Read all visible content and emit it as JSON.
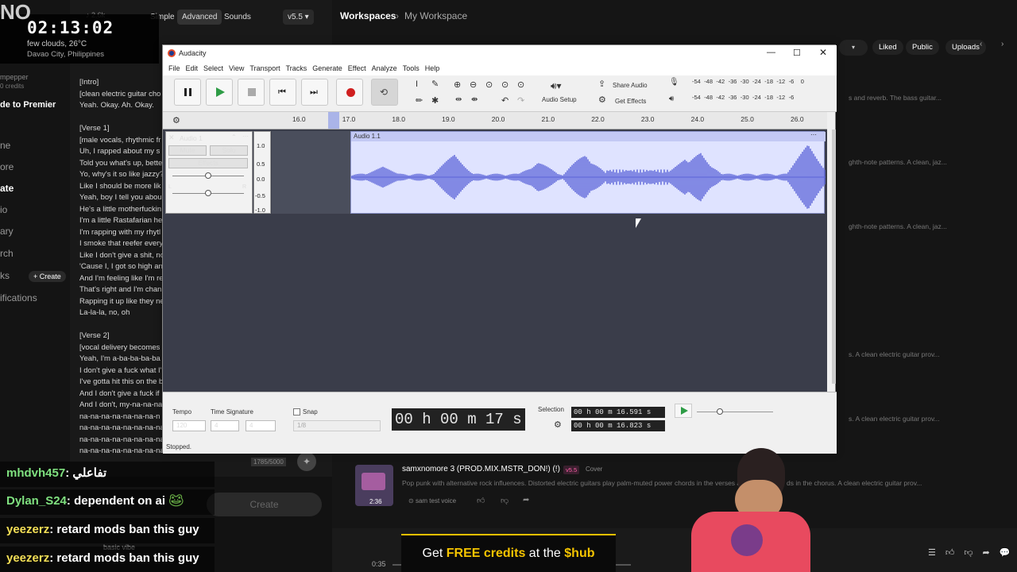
{
  "clock": {
    "time": "02:13:02",
    "weather": "few clouds, 26°C",
    "location": "Davao City, Philippines",
    "top_left": "NO"
  },
  "suno": {
    "tabs": [
      "Simple",
      "Advanced",
      "Sounds"
    ],
    "version": "v5.5",
    "breadcrumb_root": "Workspaces",
    "breadcrumb_current": "My Workspace",
    "filters": [
      "Liked",
      "Public",
      "Uploads"
    ],
    "count": "2.6k",
    "user": "mpepper",
    "credits": "0 credits",
    "upgrade": "de to Premier",
    "nav": [
      "ne",
      "ore",
      "ate",
      "io",
      "ary",
      "rch",
      "ks",
      "ifications"
    ],
    "create_small": "+ Create",
    "create": "Create",
    "lyrics": [
      "[Intro]",
      "[clean electric guitar cho",
      "Yeah. Okay. Ah. Okay.",
      "",
      "[Verse 1]",
      "[male vocals, rhythmic fr",
      "Uh, I rapped about my s",
      "Told you what's up, bette",
      "Yo, why's it so like jazzy?",
      "Like I should be more lik",
      "Yeah, boy I tell you abou",
      "He's a little motherfuckin",
      "I'm a little Rastafarian he",
      "I'm rapping with my rhytl",
      "I smoke that reefer every",
      "Like I don't give a shit, no",
      "'Cause I, I got so high an",
      "And I'm feeling like I'm re",
      "That's right and I'm chan",
      "Rapping it up like they ne",
      "La-la-la, no, oh",
      "",
      "[Verse 2]",
      "[vocal delivery becomes",
      "Yeah, I'm a-ba-ba-ba-ba",
      "I don't give a fuck what I'",
      "I've gotta hit this on the b",
      "And I don't give a fuck if",
      "And I don't, my-na-na-na",
      "na-na-na-na-na-na-na-n",
      "na-na-na-na-na-na-na-na",
      "na-na-na-na-na-na-na-na",
      "na-na-na-na-na-na-na-na-na-na-na-na"
    ],
    "lyric_counter": "1785/5000",
    "row_descs": [
      "s and reverb. The bass guitar...",
      "ghth-note patterns. A clean, jaz...",
      "ghth-note patterns. A clean, jaz...",
      "s. A clean electric guitar prov...",
      "s. A clean electric guitar prov...",
      "ds in the chorus. A clean electric guitar prov..."
    ],
    "song": {
      "title": "samxnomore 3 (PROD.MIX.MSTR_DON!) (!)",
      "badge": "v5.5",
      "tag": "Cover",
      "desc": "Pop punk with alternative rock influences. Distorted electric guitars play palm-muted power chords in the verses and",
      "duration": "2:36",
      "voice": "sam test voice"
    },
    "player_time": "0:35",
    "basic_vibe": "basic vibe"
  },
  "audacity": {
    "title": "Audacity",
    "menu": [
      "File",
      "Edit",
      "Select",
      "View",
      "Transport",
      "Tracks",
      "Generate",
      "Effect",
      "Analyze",
      "Tools",
      "Help"
    ],
    "audio_setup": "Audio Setup",
    "share_audio": "Share Audio",
    "get_effects": "Get Effects",
    "meter_ticks": [
      "-54",
      "-48",
      "-42",
      "-36",
      "-30",
      "-24",
      "-18",
      "-12",
      "-6",
      "0"
    ],
    "meter_ticks_playback": [
      "-54",
      "-48",
      "-42",
      "-36",
      "-30",
      "-24",
      "-18",
      "-12",
      "-6"
    ],
    "ruler": [
      "16.0",
      "17.0",
      "18.0",
      "19.0",
      "20.0",
      "21.0",
      "22.0",
      "23.0",
      "24.0",
      "25.0",
      "26.0"
    ],
    "track_name": "Audio 1",
    "clip_name": "Audio 1.1",
    "mute": "Mute",
    "solo": "Solo",
    "effects": "Effects",
    "scale": [
      "1.0",
      "0.5",
      "0.0",
      "-0.5",
      "-1.0"
    ],
    "tempo_label": "Tempo",
    "tempo": "120",
    "time_sig_label": "Time Signature",
    "time_sig_num": "4",
    "time_sig_den": "4",
    "snap": "Snap",
    "snap_value": "1/8",
    "time": "00 h 00 m 17 s",
    "selection_label": "Selection",
    "sel_start": "00 h 00 m 16.591 s",
    "sel_end": "00 h 00 m 16.823 s",
    "status": "Stopped."
  },
  "chat": [
    {
      "user": "mhdvh457",
      "msg": "تفاعلي"
    },
    {
      "user": "Dylan_S24",
      "msg": "dependent on ai"
    },
    {
      "user": "yeezerz",
      "msg": "retard mods ban this guy"
    },
    {
      "user": "yeezerz",
      "msg": "retard mods ban this guy"
    }
  ],
  "banner": {
    "pre": "Get ",
    "free": "FREE credits",
    "mid": " at the ",
    "hub": "$hub"
  }
}
